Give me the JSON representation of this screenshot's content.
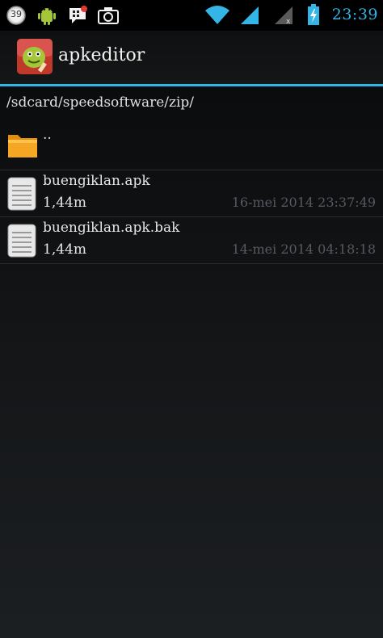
{
  "status_bar": {
    "notification_badge": "39",
    "time": "23:39"
  },
  "action_bar": {
    "title": "apkeditor"
  },
  "browser": {
    "path": "/sdcard/speedsoftware/zip/",
    "parent_label": "..",
    "files": [
      {
        "name": "buengiklan.apk",
        "size": "1,44m",
        "date": "16-mei 2014 23:37:49"
      },
      {
        "name": "buengiklan.apk.bak",
        "size": "1,44m",
        "date": "14-mei 2014 04:18:18"
      }
    ]
  },
  "colors": {
    "accent": "#33b5e5",
    "background": "#000000",
    "date_text": "#555a60"
  }
}
